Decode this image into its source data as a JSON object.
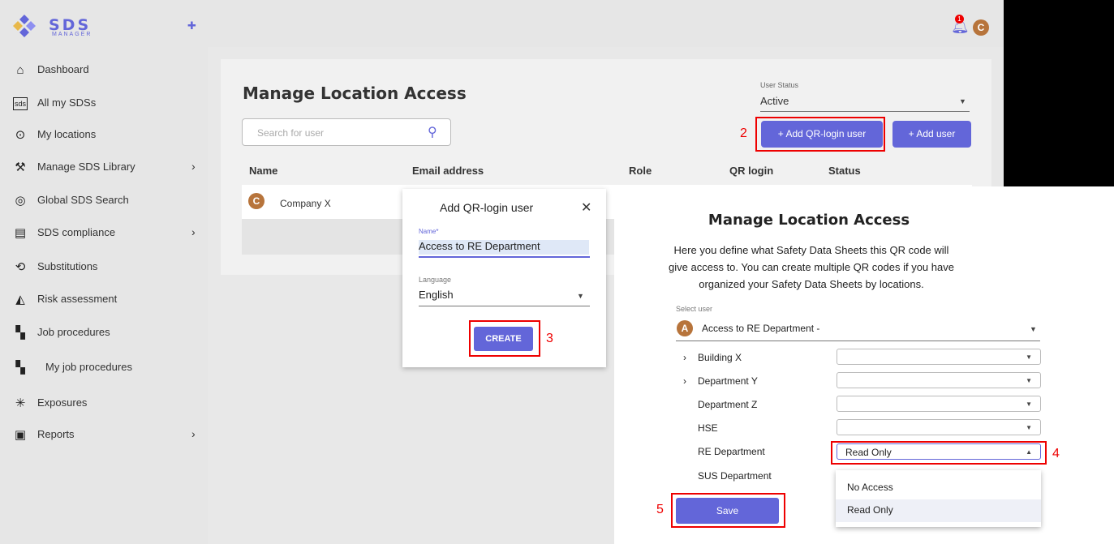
{
  "app": {
    "logo_text": "SDS",
    "logo_sub": "MANAGER"
  },
  "sidebar": {
    "items": [
      {
        "label": "Dashboard",
        "icon": "home-icon"
      },
      {
        "label": "All my SDSs",
        "icon": "sds-icon"
      },
      {
        "label": "My locations",
        "icon": "location-icon"
      },
      {
        "label": "Manage SDS Library",
        "icon": "wrench-icon"
      },
      {
        "label": "Global SDS Search",
        "icon": "global-search-icon"
      },
      {
        "label": "SDS compliance",
        "icon": "compliance-icon"
      },
      {
        "label": "Substitutions",
        "icon": "substitution-icon"
      },
      {
        "label": "Risk assessment",
        "icon": "risk-icon"
      },
      {
        "label": "Job procedures",
        "icon": "job-procedures-icon"
      },
      {
        "label": "My job procedures",
        "icon": "my-job-procedures-icon"
      },
      {
        "label": "Exposures",
        "icon": "exposure-icon"
      },
      {
        "label": "Reports",
        "icon": "reports-icon"
      }
    ]
  },
  "header": {
    "notification_count": "1",
    "avatar_initial": "C"
  },
  "main": {
    "title": "Manage Location Access",
    "search_placeholder": "Search for user",
    "user_status_label": "User Status",
    "user_status_value": "Active",
    "add_qr_button": "+ Add QR-login user",
    "add_user_button": "+ Add user",
    "columns": [
      "Name",
      "Email address",
      "Role",
      "QR login",
      "Status"
    ],
    "row": {
      "avatar": "C",
      "name": "Company X"
    }
  },
  "dialog": {
    "title": "Add QR-login user",
    "name_label": "Name*",
    "name_value": "Access to RE Department",
    "language_label": "Language",
    "language_value": "English",
    "create_button": "CREATE"
  },
  "access_panel": {
    "title": "Manage Location Access",
    "description": "Here you define what Safety Data Sheets this QR code will give access to. You can create multiple QR codes if you have organized your Safety Data Sheets by locations.",
    "select_user_label": "Select user",
    "selected_user": "Access to RE Department -",
    "selected_user_initial": "A",
    "locations": [
      {
        "name": "Building X",
        "value": ""
      },
      {
        "name": "Department Y",
        "value": ""
      },
      {
        "name": "Department Z",
        "value": ""
      },
      {
        "name": "HSE",
        "value": ""
      },
      {
        "name": "RE Department",
        "value": "Read Only"
      },
      {
        "name": "SUS Department",
        "value": ""
      }
    ],
    "dropdown_options": [
      "No Access",
      "Read Only"
    ],
    "save_button": "Save"
  },
  "annotations": {
    "n2": "2",
    "n3": "3",
    "n4": "4",
    "n5": "5"
  }
}
